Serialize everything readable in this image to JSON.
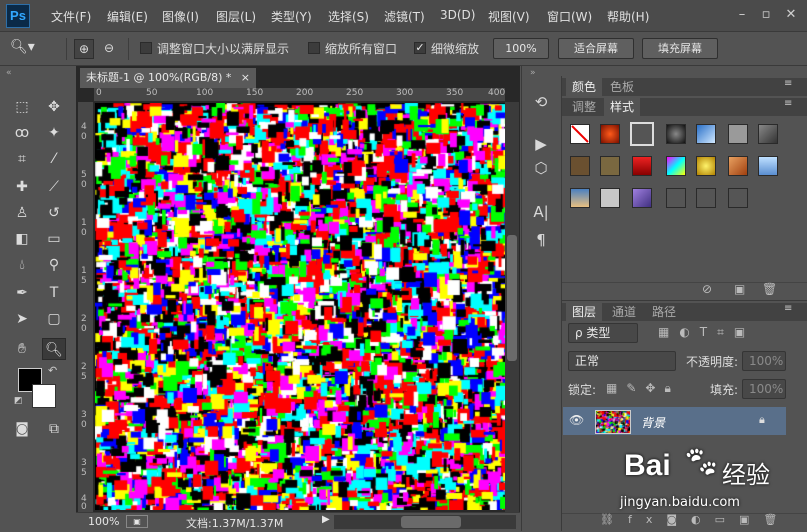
{
  "app": {
    "logo": "Ps",
    "accent": "#31a8ff"
  },
  "menu": {
    "items": [
      "文件(F)",
      "编辑(E)",
      "图像(I)",
      "图层(L)",
      "类型(Y)",
      "选择(S)",
      "滤镜(T)",
      "3D(D)",
      "视图(V)",
      "窗口(W)",
      "帮助(H)"
    ]
  },
  "window_controls": {
    "minimize": "–",
    "restore": "▫",
    "close": "✕"
  },
  "options": {
    "cb1_label": "调整窗口大小以满屏显示",
    "cb2_label": "缩放所有窗口",
    "cb3_label": "细微缩放",
    "zoom_btn": "100%",
    "fit_btn": "适合屏幕",
    "fill_btn": "填充屏幕"
  },
  "document": {
    "tab_title": "未标题-1 @ 100%(RGB/8) *",
    "tab_close": "×",
    "ruler_top": [
      "0",
      "50",
      "100",
      "150",
      "200",
      "250",
      "300",
      "350",
      "400"
    ],
    "ruler_left": [
      "4",
      "0",
      "5",
      "0",
      "1",
      "0",
      "1",
      "5",
      "2",
      "0",
      "2",
      "5",
      "3",
      "0",
      "3",
      "5",
      "4",
      "0"
    ]
  },
  "status": {
    "zoom": "100%",
    "doc_info": "文档:1.37M/1.37M"
  },
  "panels": {
    "color_tab": "颜色",
    "swatch_tab": "色板",
    "adjust_tab": "调整",
    "styles_tab": "样式",
    "layers_tab": "图层",
    "channels_tab": "通道",
    "paths_tab": "路径",
    "filter_kind": "ρ 类型",
    "blend_mode": "正常",
    "opacity_label": "不透明度:",
    "opacity_value": "100%",
    "lock_label": "锁定:",
    "fill_label": "填充:",
    "fill_value": "100%",
    "layer_name": "背景"
  },
  "watermark": {
    "brand": "Bai",
    "brand2": "经验",
    "url": "jingyan.baidu.com"
  }
}
